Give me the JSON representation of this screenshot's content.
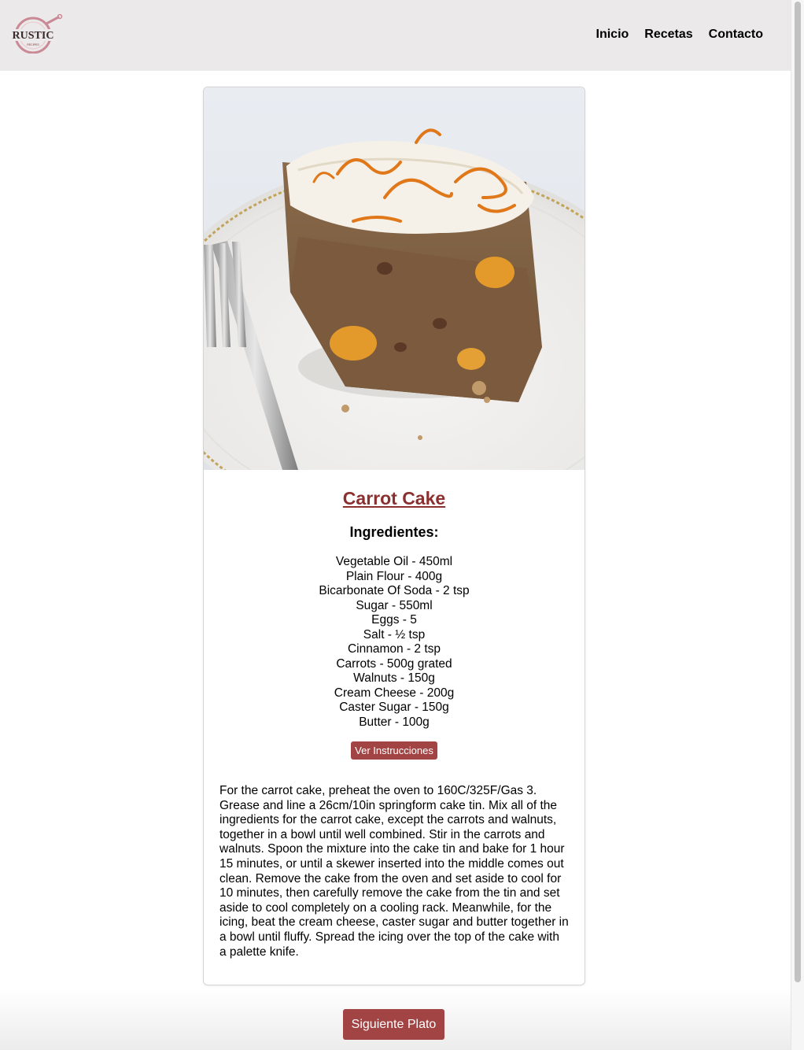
{
  "header": {
    "logo_text": "RUSTIC",
    "logo_subtext": "RECIPES",
    "nav": [
      "Inicio",
      "Recetas",
      "Contacto"
    ]
  },
  "recipe": {
    "title": "Carrot Cake",
    "ingredients_heading": "Ingredientes:",
    "ingredients": [
      "Vegetable Oil - 450ml",
      "Plain Flour - 400g",
      "Bicarbonate Of Soda - 2 tsp",
      "Sugar - 550ml",
      "Eggs - 5",
      "Salt - ½ tsp",
      "Cinnamon - 2 tsp",
      "Carrots - 500g grated",
      "Walnuts - 150g",
      "Cream Cheese - 200g",
      "Caster Sugar - 150g",
      "Butter - 100g"
    ],
    "instructions_button": "Ver Instrucciones",
    "instructions": "For the carrot cake, preheat the oven to 160C/325F/Gas 3. Grease and line a 26cm/10in springform cake tin. Mix all of the ingredients for the carrot cake, except the carrots and walnuts, together in a bowl until well combined. Stir in the carrots and walnuts. Spoon the mixture into the cake tin and bake for 1 hour 15 minutes, or until a skewer inserted into the middle comes out clean. Remove the cake from the oven and set aside to cool for 10 minutes, then carefully remove the cake from the tin and set aside to cool completely on a cooling rack. Meanwhile, for the icing, beat the cream cheese, caster sugar and butter together in a bowl until fluffy. Spread the icing over the top of the cake with a palette knife."
  },
  "footer": {
    "next_button": "Siguiente Plato"
  },
  "colors": {
    "accent": "#a34444",
    "title": "#8b2f2f",
    "header_bg": "#ebe9e9"
  }
}
